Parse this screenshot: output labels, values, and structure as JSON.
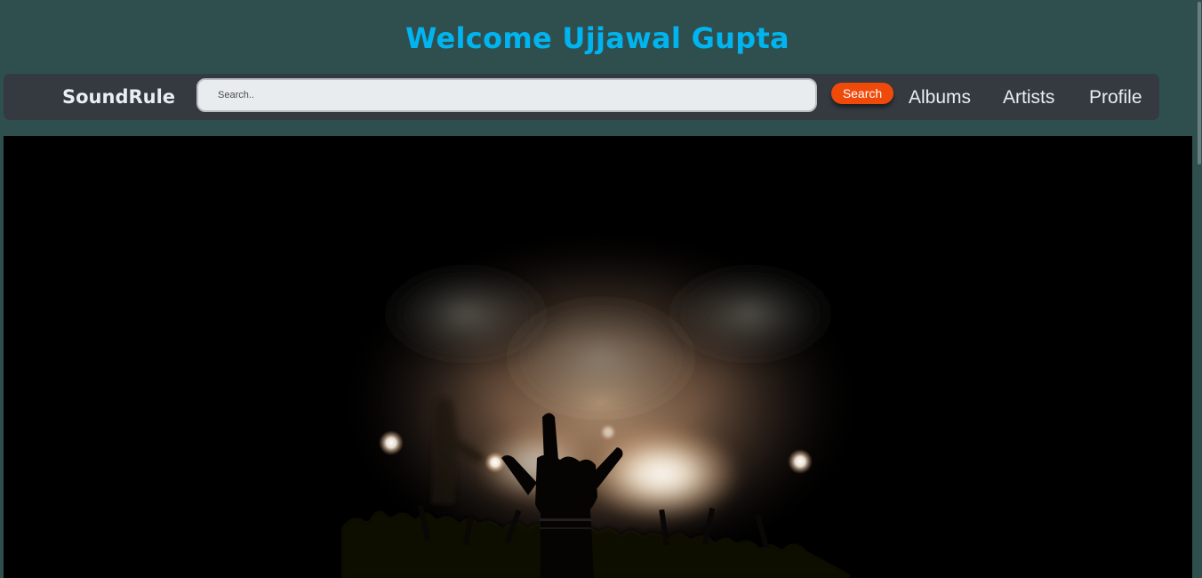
{
  "header": {
    "welcome": "Welcome Ujjawal Gupta"
  },
  "navbar": {
    "brand": "SoundRule",
    "search": {
      "placeholder": "Search..",
      "value": "",
      "button_label": "Search"
    },
    "links": [
      "Albums",
      "Artists",
      "Profile"
    ]
  },
  "colors": {
    "background": "#2f4f4f",
    "welcome_text": "#00b4f0",
    "navbar": "#343a40",
    "search_button": "#f04a0a",
    "hero_background": "#000000"
  },
  "hero": {
    "image": "concert-crowd-rock-hand"
  }
}
